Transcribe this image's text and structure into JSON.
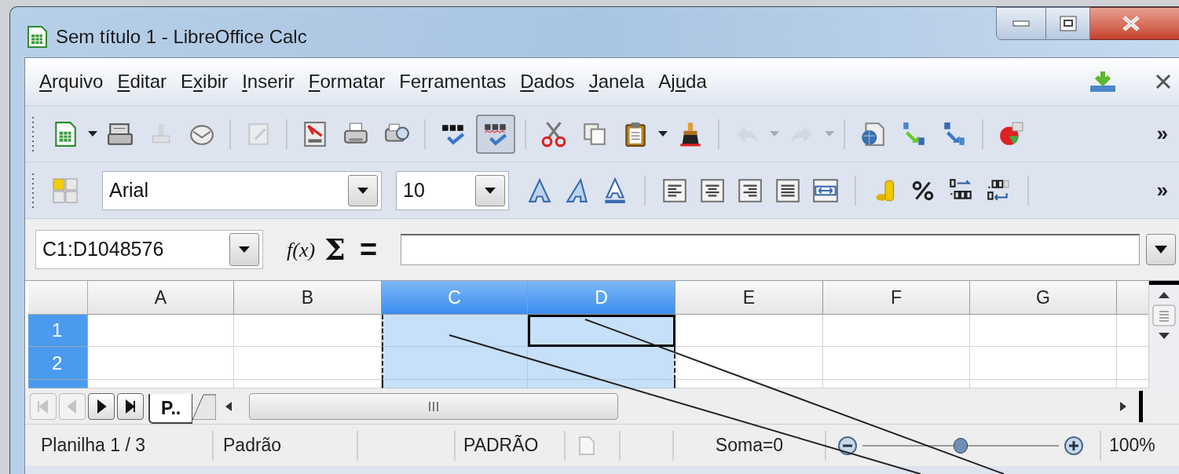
{
  "window": {
    "title": "Sem título 1 - LibreOffice Calc"
  },
  "menu": [
    {
      "key": "A",
      "post": "rquivo"
    },
    {
      "key": "E",
      "post": "ditar"
    },
    {
      "pre": "E",
      "key": "x",
      "post": "ibir"
    },
    {
      "key": "I",
      "post": "nserir"
    },
    {
      "key": "F",
      "post": "ormatar"
    },
    {
      "pre": "Fe",
      "key": "r",
      "post": "ramentas"
    },
    {
      "key": "D",
      "post": "ados"
    },
    {
      "key": "J",
      "post": "anela"
    },
    {
      "pre": "Aj",
      "key": "u",
      "post": "da"
    }
  ],
  "standard_toolbar": [
    {
      "kind": "new",
      "disabled": false,
      "selected": false,
      "dropdown": true
    },
    {
      "kind": "open",
      "disabled": false,
      "selected": false
    },
    {
      "kind": "save",
      "disabled": true,
      "selected": false
    },
    {
      "kind": "email",
      "disabled": false,
      "selected": false
    },
    {
      "kind": "separator"
    },
    {
      "kind": "edit",
      "disabled": true,
      "selected": false
    },
    {
      "kind": "separator"
    },
    {
      "kind": "pdf",
      "disabled": false,
      "selected": false
    },
    {
      "kind": "print",
      "disabled": false,
      "selected": false
    },
    {
      "kind": "preview",
      "disabled": false,
      "selected": false
    },
    {
      "kind": "separator"
    },
    {
      "kind": "spellcheck",
      "disabled": false,
      "selected": false
    },
    {
      "kind": "autospell",
      "disabled": false,
      "selected": true
    },
    {
      "kind": "separator"
    },
    {
      "kind": "cut",
      "disabled": false,
      "selected": false
    },
    {
      "kind": "copy",
      "disabled": false,
      "selected": false
    },
    {
      "kind": "paste",
      "disabled": false,
      "selected": false,
      "dropdown": true
    },
    {
      "kind": "clone",
      "disabled": false,
      "selected": false
    },
    {
      "kind": "separator"
    },
    {
      "kind": "undo",
      "disabled": true,
      "selected": false,
      "dropdown": true
    },
    {
      "kind": "redo",
      "disabled": true,
      "selected": false,
      "dropdown": true
    },
    {
      "kind": "separator"
    },
    {
      "kind": "navigator",
      "disabled": false,
      "selected": false
    },
    {
      "kind": "sort_asc",
      "disabled": false,
      "selected": false
    },
    {
      "kind": "sort_desc",
      "disabled": false,
      "selected": false
    },
    {
      "kind": "separator"
    },
    {
      "kind": "chart",
      "disabled": false,
      "selected": false
    }
  ],
  "standard_overflow": "»",
  "formatting_toolbar": {
    "font_name": "Arial",
    "font_size": "10",
    "overflow": "»",
    "items": [
      {
        "kind": "bold"
      },
      {
        "kind": "italic"
      },
      {
        "kind": "underline"
      },
      {
        "kind": "separator"
      },
      {
        "kind": "align_left"
      },
      {
        "kind": "align_center"
      },
      {
        "kind": "align_right"
      },
      {
        "kind": "justify"
      },
      {
        "kind": "merge"
      },
      {
        "kind": "separator"
      },
      {
        "kind": "currency"
      },
      {
        "kind": "percent"
      },
      {
        "kind": "add_decimal"
      },
      {
        "kind": "delete_decimal"
      },
      {
        "kind": "separator"
      }
    ]
  },
  "formula_bar": {
    "name_box": "C1:D1048576",
    "function_wizard": "f(x)",
    "sum": "Σ",
    "equals": "="
  },
  "grid": {
    "columns": [
      {
        "label": "A",
        "selected": false,
        "copied": false
      },
      {
        "label": "B",
        "selected": false,
        "copied": false
      },
      {
        "label": "C",
        "selected": true,
        "copied": true
      },
      {
        "label": "D",
        "selected": true,
        "copied": true
      },
      {
        "label": "E",
        "selected": false,
        "copied": false
      },
      {
        "label": "F",
        "selected": false,
        "copied": false
      },
      {
        "label": "G",
        "selected": false,
        "copied": false
      }
    ],
    "rows": [
      {
        "label": "1",
        "selected": true,
        "cells": [
          {
            "active": false
          },
          {
            "active": false
          },
          {
            "active": false
          },
          {
            "active": true
          },
          {
            "active": false
          },
          {
            "active": false
          },
          {
            "active": false
          }
        ]
      },
      {
        "label": "2",
        "selected": true,
        "cells": [
          {
            "active": false
          },
          {
            "active": false
          },
          {
            "active": false
          },
          {
            "active": false
          },
          {
            "active": false
          },
          {
            "active": false
          },
          {
            "active": false
          }
        ]
      }
    ]
  },
  "sheet_nav": [
    {
      "kind": "first",
      "disabled": true
    },
    {
      "kind": "prev",
      "disabled": true
    },
    {
      "kind": "next",
      "disabled": false
    },
    {
      "kind": "last",
      "disabled": false
    }
  ],
  "sheet_tabs": [
    {
      "label": "P..",
      "selected": true
    }
  ],
  "status_bar": {
    "sheet": "Planilha 1 / 3",
    "page_style": "Padrão",
    "mode": "PADRÃO",
    "modified": false,
    "sum": "Soma=0",
    "zoom_slider": {
      "level": 0.5
    },
    "zoom": "100%"
  }
}
